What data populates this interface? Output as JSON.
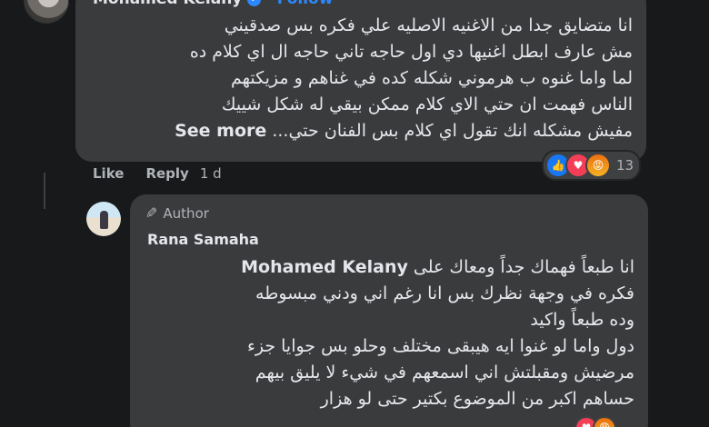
{
  "top_comment": {
    "author": "Mohamed Kelany",
    "separator": "·",
    "follow_label": "Follow",
    "lines": [
      "انا متضايق جدا من الاغنيه الاصليه علي فكره بس صدقيني",
      "مش عارف ابطل اغنيها دي اول حاجه تاني حاجه ال اي كلام ده",
      "لما واما غنوه ب هرموني شكله كده في غناهم و مزيكتهم",
      "الناس فهمت ان حتي الاي كلام ممكن بيقي له شكل شييك",
      "مفيش مشكله انك تقول اي كلام بس الفنان حتي..."
    ],
    "see_more_label": "See more",
    "actions": {
      "like_label": "Like",
      "reply_label": "Reply",
      "time": "1 d"
    },
    "reactions": {
      "icons": [
        "like-icon",
        "love-icon",
        "angry-icon"
      ],
      "count": "13"
    }
  },
  "reply": {
    "author_badge": "Author",
    "author": "Rana Samaha",
    "mention": "Mohamed Kelany",
    "first_line_text": "انا طبعاً فهماك جداً ومعاك على",
    "lines": [
      "فكره في وجهة نظرك بس انا رغم اني ودني مبسوطه",
      "وده طبعاً واكيد",
      "دول واما لو غنوا ايه هيبقى مختلف وحلو بس جوايا جزء",
      "مرضيش ومقبلتش اني اسمعهم في شيء لا يليق بيهم",
      "حساهم اكبر من الموضوع بكتير حتى لو هزار"
    ],
    "reaction_icons": [
      "love-icon",
      "angry-icon"
    ]
  },
  "colors": {
    "background": "#18191a",
    "bubble": "#3a3b3c",
    "text_primary": "#e4e6eb",
    "text_secondary": "#b0b3b8",
    "accent": "#2d88ff"
  }
}
